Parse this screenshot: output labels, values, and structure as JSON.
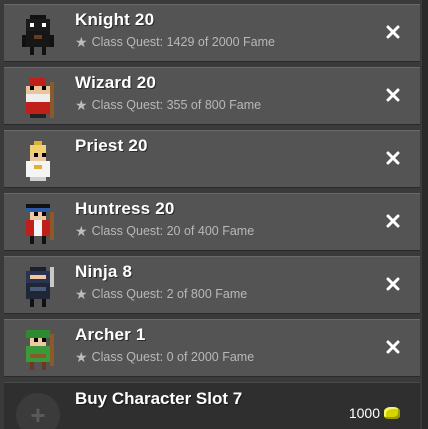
{
  "characters": [
    {
      "name": "Knight 20",
      "quest": "Class Quest: 1429 of 2000 Fame",
      "icon": "knight-icon"
    },
    {
      "name": "Wizard 20",
      "quest": "Class Quest: 355 of 800 Fame",
      "icon": "wizard-icon"
    },
    {
      "name": "Priest 20",
      "quest": "",
      "icon": "priest-icon"
    },
    {
      "name": "Huntress 20",
      "quest": "Class Quest: 20 of 400 Fame",
      "icon": "huntress-icon"
    },
    {
      "name": "Ninja 8",
      "quest": "Class Quest: 2 of 800 Fame",
      "icon": "ninja-icon"
    },
    {
      "name": "Archer 1",
      "quest": "Class Quest: 0 of 2000 Fame",
      "icon": "archer-icon"
    }
  ],
  "buy_slot": {
    "label": "Buy Character Slot 7",
    "price": "1000",
    "currency_icon": "gold-icon"
  },
  "colors": {
    "row_bg": "#545454",
    "text": "#ffffff",
    "subtext": "#b8b8b8",
    "gold": "#d4d400"
  }
}
